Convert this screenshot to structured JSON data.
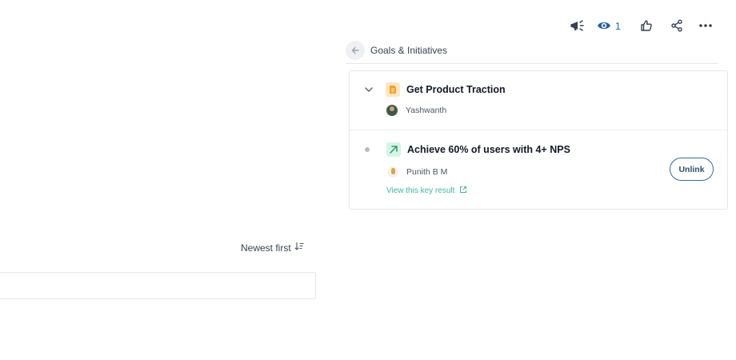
{
  "toolbar": {
    "announce_icon": "megaphone-icon",
    "views_icon": "eye-icon",
    "views_count": "1",
    "like_icon": "thumbs-up-icon",
    "share_icon": "share-icon",
    "more_icon": "more-horizontal-icon"
  },
  "goals": {
    "back_icon": "arrow-left-icon",
    "title": "Goals & Initiatives",
    "objective": {
      "icon": "objective-icon",
      "expand_icon": "chevron-down-icon",
      "title": "Get Product Traction",
      "owner": "Yashwanth"
    },
    "key_result": {
      "icon": "trend-up-icon",
      "title": "Achieve 60% of users with 4+ NPS",
      "owner": "Punith B M",
      "link_label": "View this key result",
      "link_icon": "external-link-icon",
      "unlink_label": "Unlink"
    }
  },
  "comments": {
    "sort_label": "Newest first",
    "sort_icon": "sort-descending-icon",
    "input_value": ""
  },
  "colors": {
    "accent_blue": "#2a6db8",
    "link_teal": "#3bb8a3",
    "objective_bg": "#fde7c2",
    "key_result_bg": "#d6f5e6"
  }
}
